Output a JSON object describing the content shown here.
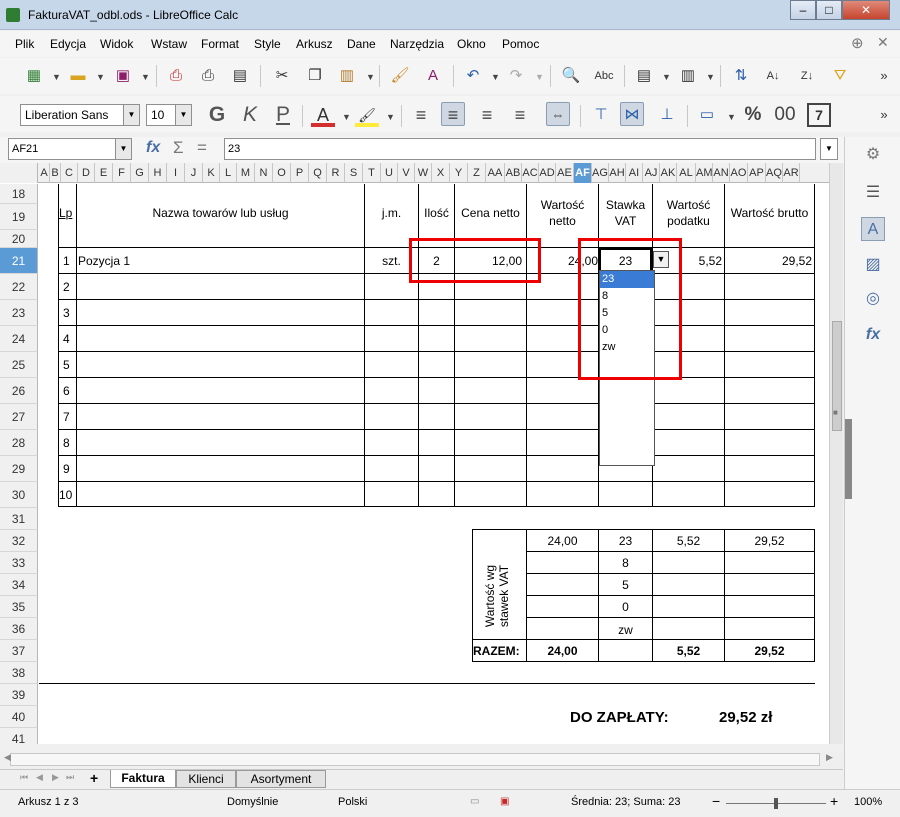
{
  "window": {
    "title": "FakturaVAT_odbl.ods - LibreOffice Calc",
    "minimize": "–",
    "maximize": "□",
    "close": "✕"
  },
  "menu": [
    "Plik",
    "Edycja",
    "Widok",
    "Wstaw",
    "Format",
    "Style",
    "Arkusz",
    "Dane",
    "Narzędzia",
    "Okno",
    "Pomoc"
  ],
  "formatting": {
    "font_name": "Liberation Sans",
    "font_size": "10"
  },
  "formula_bar": {
    "cell_ref": "AF21",
    "content": "23",
    "fx": "fx",
    "sum": "Σ",
    "eq": "="
  },
  "columns": [
    "A",
    "B",
    "C",
    "D",
    "E",
    "F",
    "G",
    "H",
    "I",
    "J",
    "K",
    "L",
    "M",
    "N",
    "O",
    "P",
    "Q",
    "R",
    "S",
    "T",
    "U",
    "V",
    "W",
    "X",
    "Y",
    "Z",
    "AA",
    "AB",
    "AC",
    "AD",
    "AE",
    "AF",
    "AG",
    "AH",
    "AI",
    "AJ",
    "AK",
    "AL",
    "AM",
    "AN",
    "AO",
    "AP",
    "AQ",
    "AR"
  ],
  "active_column": "AF",
  "rows": [
    "18",
    "19",
    "20",
    "21",
    "22",
    "23",
    "24",
    "25",
    "26",
    "27",
    "28",
    "29",
    "30",
    "31",
    "32",
    "33",
    "34",
    "35",
    "36",
    "37",
    "38",
    "39",
    "40",
    "41"
  ],
  "active_row": "21",
  "table": {
    "headers": {
      "lp": "Lp",
      "name": "Nazwa towarów lub usług",
      "unit": "j.m.",
      "qty": "Ilość",
      "price": "Cena netto",
      "net1": "Wartość",
      "net2": "netto",
      "rate1": "Stawka",
      "rate2": "VAT",
      "tax1": "Wartość",
      "tax2": "podatku",
      "gross": "Wartość brutto"
    },
    "row1": {
      "lp": "1",
      "name": "Pozycja 1",
      "unit": "szt.",
      "qty": "2",
      "price": "12,00",
      "net": "24,00",
      "rate": "23",
      "tax": "5,52",
      "gross": "29,52"
    },
    "lp_numbers": [
      "2",
      "3",
      "4",
      "5",
      "6",
      "7",
      "8",
      "9",
      "10"
    ]
  },
  "dropdown_options": [
    "23",
    "8",
    "5",
    "0",
    "zw"
  ],
  "dropdown_selected": "23",
  "summary": {
    "side_label1": "Wartość wg",
    "side_label2": "stawek VAT",
    "r1": {
      "net": "24,00",
      "rate": "23",
      "tax": "5,52",
      "gross": "29,52"
    },
    "rates": [
      "8",
      "5",
      "0",
      "zw"
    ],
    "total": {
      "label": "RAZEM:",
      "net": "24,00",
      "tax": "5,52",
      "gross": "29,52"
    }
  },
  "due": {
    "label": "DO ZAPŁATY:",
    "value": "29,52 zł"
  },
  "sheets": [
    "Faktura",
    "Klienci",
    "Asortyment"
  ],
  "active_sheet": "Faktura",
  "status": {
    "sheet": "Arkusz 1 z 3",
    "style": "Domyślnie",
    "lang": "Polski",
    "stats": "Średnia: 23; Suma: 23",
    "zoom": "100%",
    "zoom_level_percent": 100
  }
}
